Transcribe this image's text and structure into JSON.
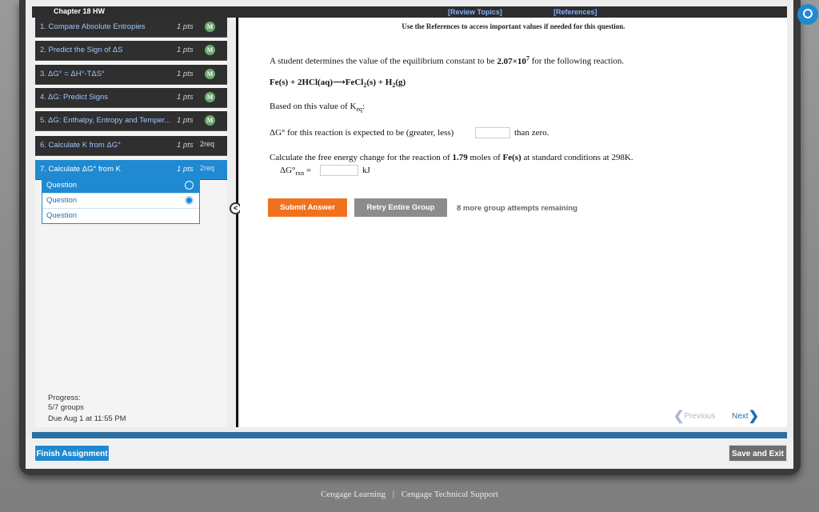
{
  "topbar": {
    "chapter": "Chapter 18 HW",
    "review_topics": "[Review Topics]",
    "references": "[References]"
  },
  "sidebar": {
    "items": [
      {
        "label": "1. Compare Absolute Entropies",
        "pts": "1 pts",
        "badge": "M"
      },
      {
        "label": "2. Predict the Sign of ΔS",
        "pts": "1 pts",
        "badge": "M"
      },
      {
        "label": "3. ΔG° = ΔH°-TΔS°",
        "pts": "1 pts",
        "badge": "M"
      },
      {
        "label": "4. ΔG: Predict Signs",
        "pts": "1 pts",
        "badge": "M"
      },
      {
        "label": "5. ΔG: Enthalpy, Entropy and Temper...",
        "pts": "1 pts",
        "badge": "M"
      },
      {
        "label": "6. Calculate K from ΔG°",
        "pts": "1 pts",
        "badge": "2req"
      },
      {
        "label": "7. Calculate ΔG° from K",
        "pts": "1 pts",
        "badge": "2req"
      }
    ],
    "subitems": [
      "Question",
      "Question",
      "Question"
    ],
    "progress_label": "Progress:",
    "progress_value": "5/7 groups",
    "due": "Due Aug 1 at 11:55 PM"
  },
  "content": {
    "notice": "Use the References to access important values if needed for this question.",
    "intro_prefix": "A student determines the value of the equilibrium constant to be ",
    "k_mantissa": "2.07×10",
    "k_exponent": "7",
    "intro_suffix": " for the following reaction.",
    "reaction": {
      "fe": "Fe(s) + 2HCl(aq)",
      "arrow": "⟶",
      "fecl": "FeCl",
      "fecl_sub": "2",
      "fecl_state": "(s) + H",
      "h_sub": "2",
      "h_state": "(g)"
    },
    "based_prefix": "Based on this value of K",
    "based_sub": "eq",
    "based_suffix": ":",
    "dg_prefix": "ΔG° for this reaction is expected to be (greater, less)",
    "dg_suffix": "than zero.",
    "calc_prefix": "Calculate the free energy change for the reaction of ",
    "calc_moles": "1.79",
    "calc_mid": " moles of ",
    "calc_species": "Fe(s)",
    "calc_suffix": " at standard conditions at 298K.",
    "dgrxn_label": "ΔG°",
    "dgrxn_sub": "rxn",
    "dgrxn_eq": " =",
    "unit": "kJ"
  },
  "actions": {
    "submit": "Submit Answer",
    "retry": "Retry Entire Group",
    "attempts": "8 more group attempts remaining",
    "previous": "Previous",
    "next": "Next",
    "finish": "Finish Assignment",
    "save_exit": "Save and Exit"
  },
  "footer": {
    "brand": "Cengage Learning",
    "sep": "|",
    "support": "Cengage Technical Support"
  },
  "colors": {
    "accent": "#1f8ad1",
    "submit": "#f1721e",
    "nav_bg": "#2f2f2f"
  }
}
